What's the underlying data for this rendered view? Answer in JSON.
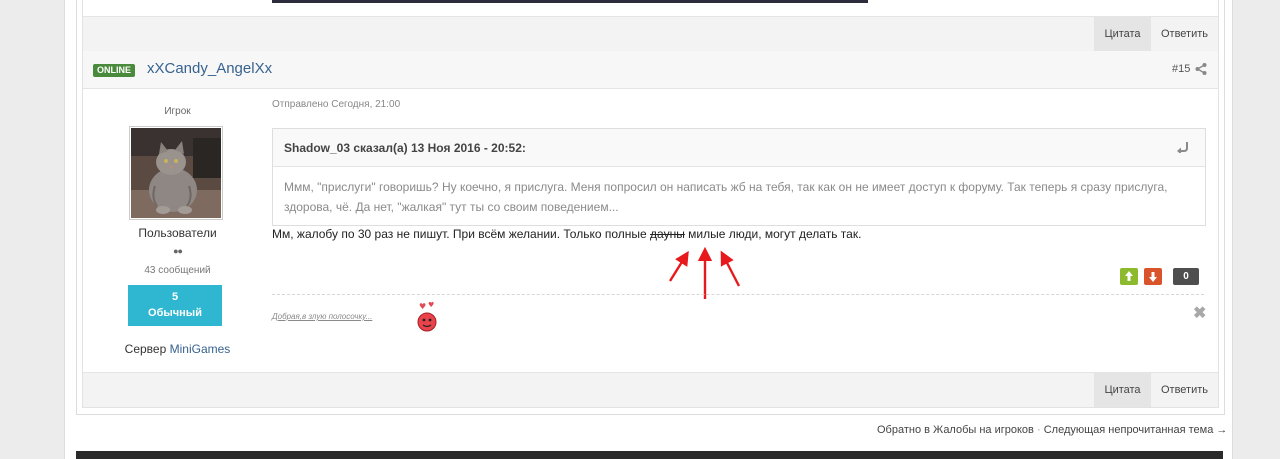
{
  "post": {
    "status_badge": "ONLINE",
    "username": "xXCandy_AngelXx",
    "number": "#15",
    "date": "Отправлено Сегодня, 21:00",
    "author": {
      "role": "Игрок",
      "group": "Пользователи",
      "pips": "●●",
      "post_count": "43 сообщений",
      "reputation_value": "5",
      "reputation_label": "Обычный",
      "server_prefix": "Сервер",
      "server_name": "MiniGames"
    },
    "quote": {
      "author": "Shadow_03 сказал(а) 13 Ноя 2016 - 20:52:",
      "text": "Ммм, \"прислуги\" говоришь? Ну коечно, я прислуга. Меня попросил он написать жб на тебя, так как он не имеет доступ к форуму. Так теперь я сразу прислуга, здорова, чё. Да нет, \"жалкая\" тут ты со своим поведением..."
    },
    "message": {
      "before": "Мм, жалобу по 30 раз не пишут. При всём желании. Только полные ",
      "struck": "дауны",
      "after": " милые люди, могут делать так."
    },
    "votes": {
      "count": "0"
    },
    "signature": "Добрая,в злую полосочку..."
  },
  "buttons": {
    "quote_label": "Цитата",
    "reply_label": "Ответить"
  },
  "footer": {
    "back_link": "Обратно в Жалобы на игроков",
    "separator": "·",
    "next_link": "Следующая непрочитанная тема →"
  },
  "colors": {
    "online_badge": "#4a8a3c",
    "username": "#37628f",
    "reputation": "#2fb6d0",
    "vote_up": "#8cba2c",
    "vote_down": "#d9542b",
    "annotation_arrows": "#e8191c"
  }
}
